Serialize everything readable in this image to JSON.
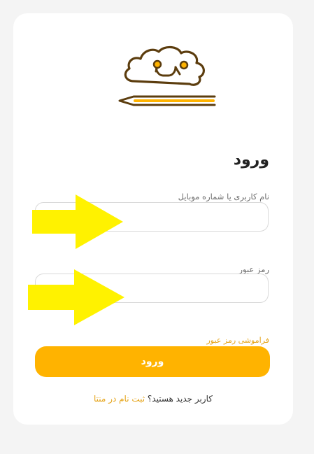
{
  "login": {
    "title": "ورود",
    "username_label": "نام کاربری یا شماره موبایل",
    "username_value": "",
    "password_label": "رمز عبور",
    "password_value": "",
    "forgot_password": "فراموشی رمز عبور",
    "submit_label": "ورود",
    "signup_prompt": "کاربر جدید هستید؟",
    "signup_link": "ثبت نام در منتا"
  },
  "colors": {
    "accent": "#ffb300",
    "link": "#e5a316",
    "logo_outline": "#5c3d0e",
    "annotation_arrow": "#fff200",
    "background": "#f4f4f4",
    "card": "#ffffff"
  },
  "icons": {
    "logo": "brain-pencil-logo",
    "annotation": "arrow-right-icon"
  }
}
